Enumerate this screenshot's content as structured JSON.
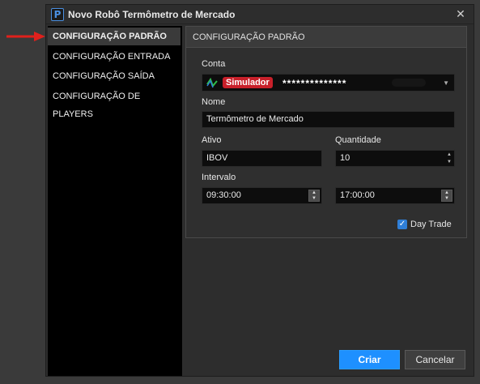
{
  "window": {
    "title": "Novo Robô Termômetro de Mercado",
    "close": "✕"
  },
  "sidebar": {
    "items": [
      {
        "label": "CONFIGURAÇÃO PADRÃO",
        "active": true
      },
      {
        "label": "CONFIGURAÇÃO ENTRADA",
        "active": false
      },
      {
        "label": "CONFIGURAÇÃO SAÍDA",
        "active": false
      },
      {
        "label": "CONFIGURAÇÃO DE PLAYERS",
        "active": false
      }
    ]
  },
  "panel": {
    "header": "CONFIGURAÇÃO PADRÃO",
    "conta": {
      "label": "Conta",
      "badge": "Simulador",
      "masked": "**************",
      "badge_color": "#c8202a"
    },
    "nome": {
      "label": "Nome",
      "value": "Termômetro de Mercado"
    },
    "ativo": {
      "label": "Ativo",
      "value": "IBOV"
    },
    "quantidade": {
      "label": "Quantidade",
      "value": "10"
    },
    "intervalo": {
      "label": "Intervalo",
      "start": "09:30:00",
      "end": "17:00:00"
    },
    "day_trade": {
      "label": "Day Trade",
      "checked": true
    }
  },
  "buttons": {
    "criar": "Criar",
    "cancelar": "Cancelar"
  },
  "colors": {
    "primary": "#1e90ff",
    "annotation_arrow": "#e0201c"
  }
}
